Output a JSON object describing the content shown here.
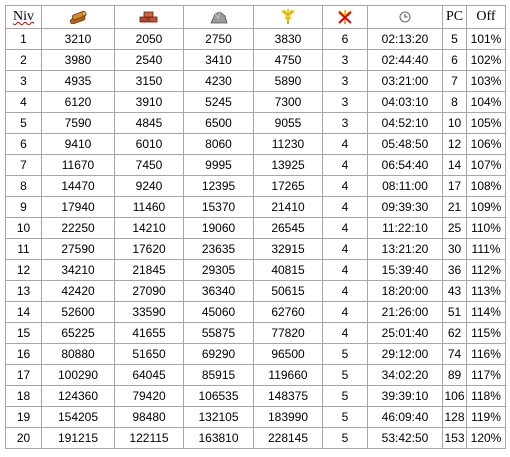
{
  "header": {
    "level_label": "Niv",
    "wood_icon": "wood-icon",
    "clay_icon": "clay-icon",
    "iron_icon": "iron-icon",
    "crop_icon": "crop-icon",
    "crop_upkeep_icon": "crop-upkeep-icon",
    "time_icon": "clock-icon",
    "pc_label": "PC",
    "off_label": "Off"
  },
  "rows": [
    {
      "niv": "1",
      "wood": "3210",
      "clay": "2050",
      "iron": "2750",
      "crop": "3830",
      "upkeep": "6",
      "time": "02:13:20",
      "pc": "5",
      "off": "101%"
    },
    {
      "niv": "2",
      "wood": "3980",
      "clay": "2540",
      "iron": "3410",
      "crop": "4750",
      "upkeep": "3",
      "time": "02:44:40",
      "pc": "6",
      "off": "102%"
    },
    {
      "niv": "3",
      "wood": "4935",
      "clay": "3150",
      "iron": "4230",
      "crop": "5890",
      "upkeep": "3",
      "time": "03:21:00",
      "pc": "7",
      "off": "103%"
    },
    {
      "niv": "4",
      "wood": "6120",
      "clay": "3910",
      "iron": "5245",
      "crop": "7300",
      "upkeep": "3",
      "time": "04:03:10",
      "pc": "8",
      "off": "104%"
    },
    {
      "niv": "5",
      "wood": "7590",
      "clay": "4845",
      "iron": "6500",
      "crop": "9055",
      "upkeep": "3",
      "time": "04:52:10",
      "pc": "10",
      "off": "105%"
    },
    {
      "niv": "6",
      "wood": "9410",
      "clay": "6010",
      "iron": "8060",
      "crop": "11230",
      "upkeep": "4",
      "time": "05:48:50",
      "pc": "12",
      "off": "106%"
    },
    {
      "niv": "7",
      "wood": "11670",
      "clay": "7450",
      "iron": "9995",
      "crop": "13925",
      "upkeep": "4",
      "time": "06:54:40",
      "pc": "14",
      "off": "107%"
    },
    {
      "niv": "8",
      "wood": "14470",
      "clay": "9240",
      "iron": "12395",
      "crop": "17265",
      "upkeep": "4",
      "time": "08:11:00",
      "pc": "17",
      "off": "108%"
    },
    {
      "niv": "9",
      "wood": "17940",
      "clay": "11460",
      "iron": "15370",
      "crop": "21410",
      "upkeep": "4",
      "time": "09:39:30",
      "pc": "21",
      "off": "109%"
    },
    {
      "niv": "10",
      "wood": "22250",
      "clay": "14210",
      "iron": "19060",
      "crop": "26545",
      "upkeep": "4",
      "time": "11:22:10",
      "pc": "25",
      "off": "110%"
    },
    {
      "niv": "11",
      "wood": "27590",
      "clay": "17620",
      "iron": "23635",
      "crop": "32915",
      "upkeep": "4",
      "time": "13:21:20",
      "pc": "30",
      "off": "111%"
    },
    {
      "niv": "12",
      "wood": "34210",
      "clay": "21845",
      "iron": "29305",
      "crop": "40815",
      "upkeep": "4",
      "time": "15:39:40",
      "pc": "36",
      "off": "112%"
    },
    {
      "niv": "13",
      "wood": "42420",
      "clay": "27090",
      "iron": "36340",
      "crop": "50615",
      "upkeep": "4",
      "time": "18:20:00",
      "pc": "43",
      "off": "113%"
    },
    {
      "niv": "14",
      "wood": "52600",
      "clay": "33590",
      "iron": "45060",
      "crop": "62760",
      "upkeep": "4",
      "time": "21:26:00",
      "pc": "51",
      "off": "114%"
    },
    {
      "niv": "15",
      "wood": "65225",
      "clay": "41655",
      "iron": "55875",
      "crop": "77820",
      "upkeep": "4",
      "time": "25:01:40",
      "pc": "62",
      "off": "115%"
    },
    {
      "niv": "16",
      "wood": "80880",
      "clay": "51650",
      "iron": "69290",
      "crop": "96500",
      "upkeep": "5",
      "time": "29:12:00",
      "pc": "74",
      "off": "116%"
    },
    {
      "niv": "17",
      "wood": "100290",
      "clay": "64045",
      "iron": "85915",
      "crop": "119660",
      "upkeep": "5",
      "time": "34:02:20",
      "pc": "89",
      "off": "117%"
    },
    {
      "niv": "18",
      "wood": "124360",
      "clay": "79420",
      "iron": "106535",
      "crop": "148375",
      "upkeep": "5",
      "time": "39:39:10",
      "pc": "106",
      "off": "118%"
    },
    {
      "niv": "19",
      "wood": "154205",
      "clay": "98480",
      "iron": "132105",
      "crop": "183990",
      "upkeep": "5",
      "time": "46:09:40",
      "pc": "128",
      "off": "119%"
    },
    {
      "niv": "20",
      "wood": "191215",
      "clay": "122115",
      "iron": "163810",
      "crop": "228145",
      "upkeep": "5",
      "time": "53:42:50",
      "pc": "153",
      "off": "120%"
    }
  ]
}
